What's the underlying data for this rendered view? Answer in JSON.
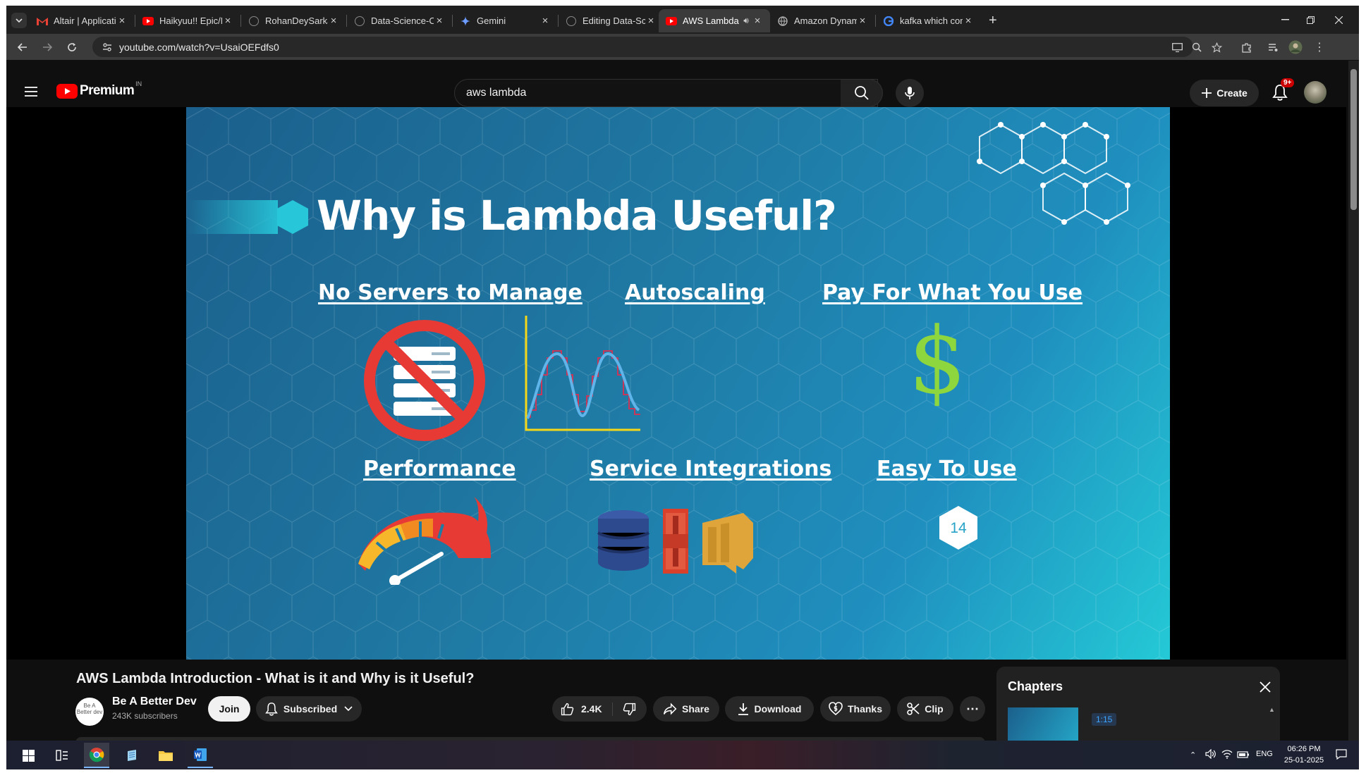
{
  "browser": {
    "tabs": [
      {
        "title": "Altair | Application St",
        "icon": "gmail-icon"
      },
      {
        "title": "Haikyuu!! Epic/Motiv",
        "icon": "youtube-icon"
      },
      {
        "title": "RohanDeySarkar/Mis",
        "icon": "github-icon"
      },
      {
        "title": "Data-Science-Course",
        "icon": "github-icon"
      },
      {
        "title": "Gemini",
        "icon": "gemini-icon"
      },
      {
        "title": "Editing Data-Science",
        "icon": "github-icon"
      },
      {
        "title": "AWS Lambda Intr",
        "icon": "youtube-icon",
        "active": true,
        "audio": true
      },
      {
        "title": "Amazon DynamoDB",
        "icon": "globe-icon"
      },
      {
        "title": "kafka which compan",
        "icon": "google-icon"
      }
    ],
    "new_tab": "+",
    "url": "youtube.com/watch?v=UsaiOEFdfs0"
  },
  "youtube": {
    "logo_text": "Premium",
    "region": "IN",
    "search_value": "aws lambda",
    "create_label": "Create",
    "notification_count": "9+"
  },
  "slide": {
    "title": "Why is Lambda Useful?",
    "headings": [
      "No Servers to Manage",
      "Autoscaling",
      "Pay For What You Use",
      "Performance",
      "Service Integrations",
      "Easy To Use"
    ],
    "dollar": "$",
    "page_number": "14"
  },
  "video": {
    "title": "AWS Lambda Introduction - What is it and Why is it Useful?",
    "channel_name": "Be A Better Dev",
    "subscribers": "243K subscribers",
    "avatar_text": "Be A Better dev",
    "join_label": "Join",
    "subscribed_label": "Subscribed",
    "likes": "2.4K",
    "share_label": "Share",
    "download_label": "Download",
    "thanks_label": "Thanks",
    "clip_label": "Clip",
    "more": "⋯"
  },
  "chapters": {
    "title": "Chapters",
    "first_time": "1:15"
  },
  "taskbar": {
    "lang": "ENG",
    "time": "06:26 PM",
    "date": "25-01-2025"
  },
  "colors": {
    "youtube_red": "#ff0000",
    "accent_blue": "#3ea6ff",
    "slide_cyan": "#27c6d8"
  }
}
